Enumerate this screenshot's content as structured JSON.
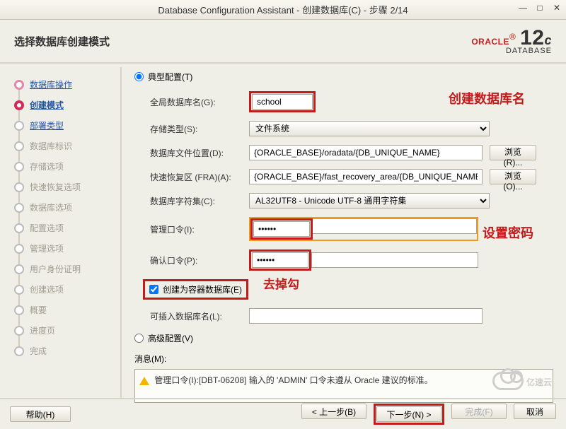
{
  "window": {
    "title": "Database Configuration Assistant - 创建数据库(C)  -  步骤 2/14"
  },
  "page_title": "选择数据库创建模式",
  "brand": {
    "name": "ORACLE",
    "product": "DATABASE",
    "ver": "12",
    "sup": "c"
  },
  "sidebar": {
    "items": [
      {
        "label": "数据库操作",
        "state": "done",
        "link": true
      },
      {
        "label": "创建模式",
        "state": "cur",
        "link": true
      },
      {
        "label": "部署类型",
        "state": "open",
        "link": true
      },
      {
        "label": "数据库标识",
        "state": "dis"
      },
      {
        "label": "存储选项",
        "state": "dis"
      },
      {
        "label": "快速恢复选项",
        "state": "dis"
      },
      {
        "label": "数据库选项",
        "state": "dis"
      },
      {
        "label": "配置选项",
        "state": "dis"
      },
      {
        "label": "管理选项",
        "state": "dis"
      },
      {
        "label": "用户身份证明",
        "state": "dis"
      },
      {
        "label": "创建选项",
        "state": "dis"
      },
      {
        "label": "概要",
        "state": "dis"
      },
      {
        "label": "进度页",
        "state": "dis"
      },
      {
        "label": "完成",
        "state": "dis"
      }
    ]
  },
  "config": {
    "typical_label": "典型配置(T)",
    "advanced_label": "高级配置(V)",
    "selected": "typical",
    "global_db_label": "全局数据库名(G):",
    "global_db_value": "school",
    "storage_label": "存储类型(S):",
    "storage_value": "文件系统",
    "file_loc_label": "数据库文件位置(D):",
    "file_loc_value": "{ORACLE_BASE}/oradata/{DB_UNIQUE_NAME}",
    "fra_label": "快速恢复区 (FRA)(A):",
    "fra_value": "{ORACLE_BASE}/fast_recovery_area/{DB_UNIQUE_NAME}",
    "charset_label": "数据库字符集(C):",
    "charset_value": "AL32UTF8 - Unicode UTF-8 通用字符集",
    "admin_pwd_label": "管理口令(I):",
    "admin_pwd_value": "••••••",
    "confirm_pwd_label": "确认口令(P):",
    "confirm_pwd_value": "••••••",
    "container_label": "创建为容器数据库(E)",
    "container_checked": true,
    "pdb_name_label": "可插入数据库名(L):",
    "pdb_name_value": "",
    "browse_label": "浏览(R)...",
    "browse_label2": "浏览(O)..."
  },
  "annotations": {
    "dbname": "创建数据库名",
    "pwd": "设置密码",
    "unchk": "去掉勾"
  },
  "messages": {
    "label": "消息(M):",
    "text": "管理口令(I):[DBT-06208] 输入的 'ADMIN' 口令未遵从 Oracle 建议的标准。"
  },
  "buttons": {
    "help": "帮助(H)",
    "back": "< 上一步(B)",
    "next": "下一步(N) >",
    "finish": "完成(F)",
    "cancel": "取消"
  },
  "watermark": "亿速云"
}
